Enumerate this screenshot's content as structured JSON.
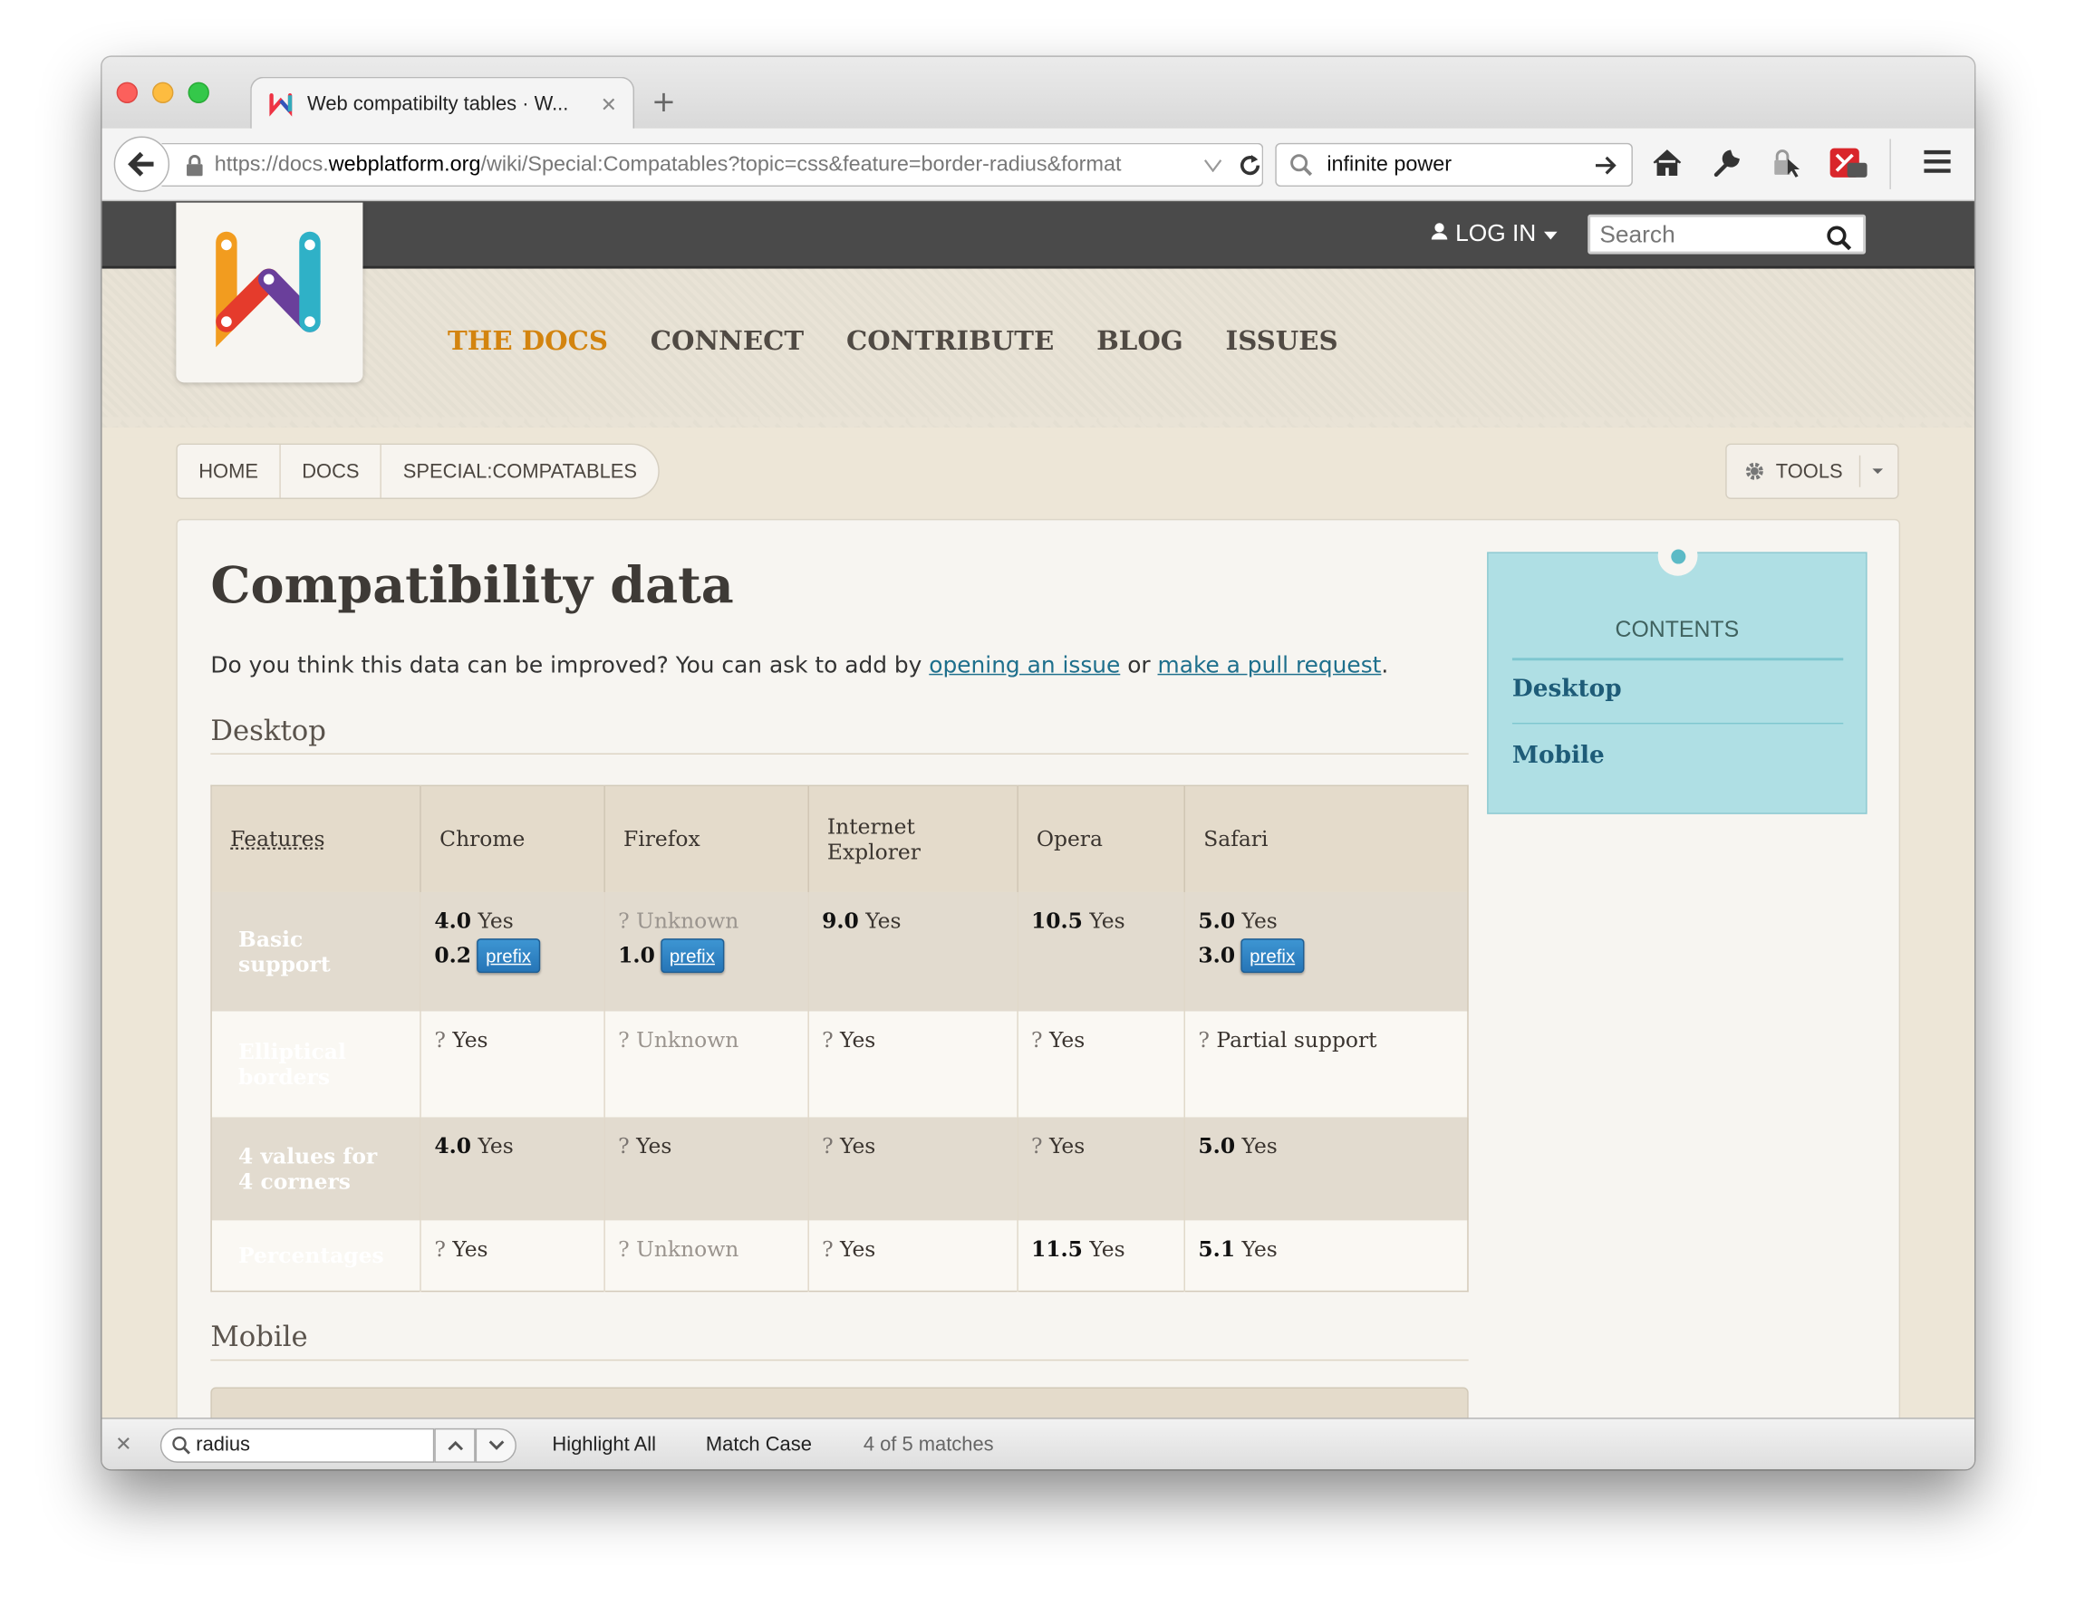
{
  "browser": {
    "tab_title": "Web compatibilty tables · W...",
    "url_prefix": "https://docs.",
    "url_domain": "webplatform.org",
    "url_path": "/wiki/Special:Compatables?topic=css&feature=border-radius&format",
    "search_value": "infinite power",
    "new_tab_symbol": "+",
    "close_symbol": "✕"
  },
  "site": {
    "login_label": "LOG IN",
    "search_placeholder": "Search",
    "nav": [
      "THE DOCS",
      "CONNECT",
      "CONTRIBUTE",
      "BLOG",
      "ISSUES"
    ],
    "breadcrumbs": [
      "HOME",
      "DOCS",
      "SPECIAL:COMPATABLES"
    ],
    "tools_label": "TOOLS",
    "accent_color": "#d3840f"
  },
  "page": {
    "title": "Compatibility data",
    "intro_before": "Do you think this data can be improved? You can ask to add by ",
    "intro_link1": "opening an issue",
    "intro_mid": " or ",
    "intro_link2": "make a pull request",
    "intro_after": ".",
    "desktop_heading": "Desktop",
    "mobile_heading": "Mobile"
  },
  "table": {
    "headers": [
      "Features",
      "Chrome",
      "Firefox",
      "Internet Explorer",
      "Opera",
      "Safari"
    ],
    "rows": [
      {
        "feature": "Basic support",
        "c1a_ver": "4.0",
        "c1a_txt": "Yes",
        "c1b_ver": "0.2",
        "c1b_tag": "prefix",
        "c2a_q": "?",
        "c2a_txt": "Unknown",
        "c2b_ver": "1.0",
        "c2b_tag": "prefix",
        "c3_ver": "9.0",
        "c3_txt": "Yes",
        "c4_ver": "10.5",
        "c4_txt": "Yes",
        "c5a_ver": "5.0",
        "c5a_txt": "Yes",
        "c5b_ver": "3.0",
        "c5b_tag": "prefix"
      },
      {
        "feature": "Elliptical borders",
        "c1_q": "?",
        "c1_txt": "Yes",
        "c2_q": "?",
        "c2_txt": "Unknown",
        "c3_q": "?",
        "c3_txt": "Yes",
        "c4_q": "?",
        "c4_txt": "Yes",
        "c5_q": "?",
        "c5_txt": "Partial support"
      },
      {
        "feature": "4 values for 4 corners",
        "c1_ver": "4.0",
        "c1_txt": "Yes",
        "c2_q": "?",
        "c2_txt": "Yes",
        "c3_q": "?",
        "c3_txt": "Yes",
        "c4_q": "?",
        "c4_txt": "Yes",
        "c5_ver": "5.0",
        "c5_txt": "Yes"
      },
      {
        "feature": "Percentages",
        "c1_q": "?",
        "c1_txt": "Yes",
        "c2_q": "?",
        "c2_txt": "Unknown",
        "c3_q": "?",
        "c3_txt": "Yes",
        "c4_ver": "11.5",
        "c4_txt": "Yes",
        "c5_ver": "5.1",
        "c5_txt": "Yes"
      }
    ]
  },
  "toc": {
    "title": "CONTENTS",
    "items": [
      "Desktop",
      "Mobile"
    ]
  },
  "findbar": {
    "query": "radius",
    "highlight_all": "Highlight All",
    "match_case": "Match Case",
    "status": "4 of 5 matches"
  }
}
